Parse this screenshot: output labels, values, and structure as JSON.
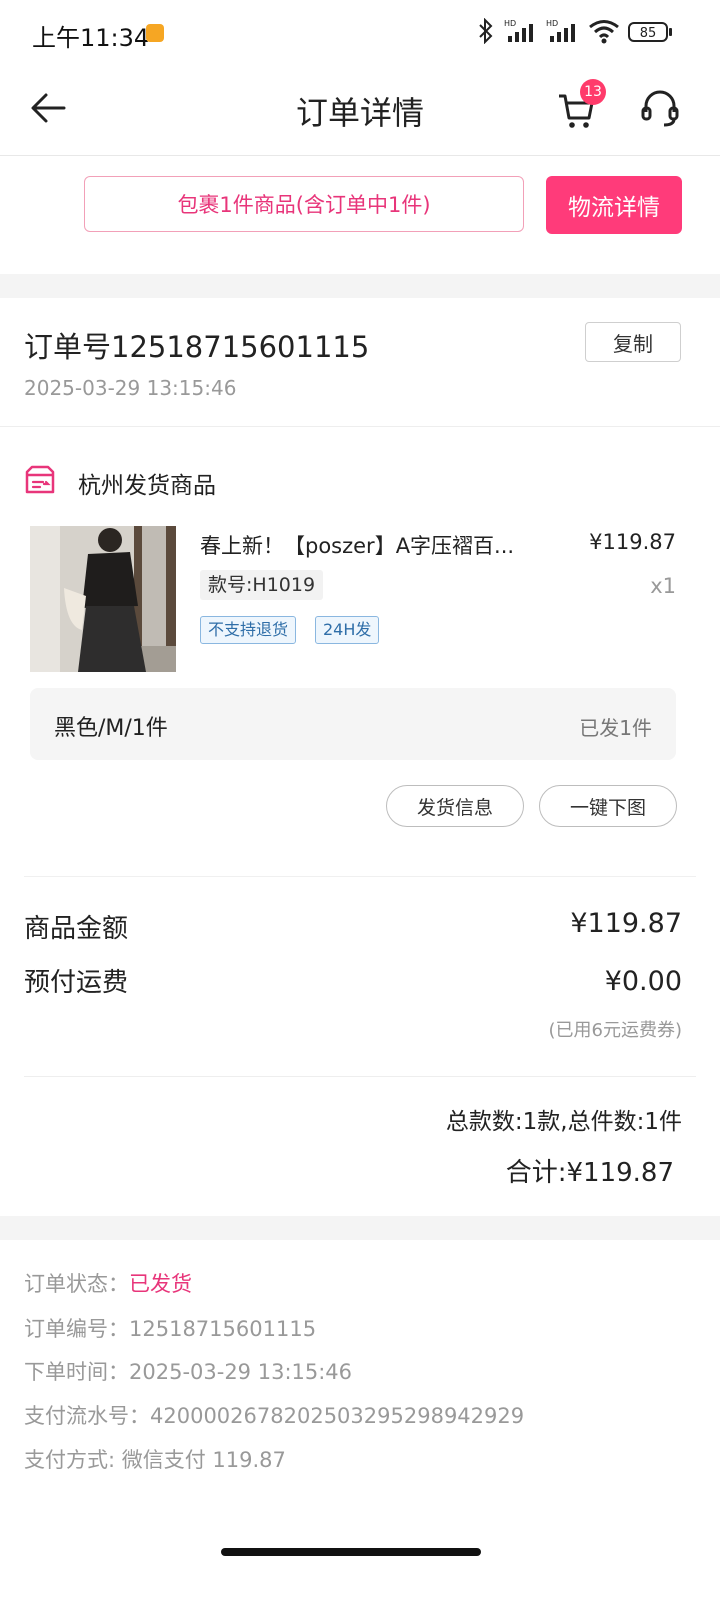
{
  "status_bar": {
    "time": "上午11:34",
    "battery": "85",
    "icons": [
      "bluetooth-icon",
      "signal-hd-icon",
      "signal-hd-icon",
      "wifi-icon",
      "battery-icon"
    ]
  },
  "header": {
    "title": "订单详情",
    "cart_badge": "13"
  },
  "package": {
    "summary": "包裹1件商品(含订单中1件)",
    "logistics_button": "物流详情"
  },
  "order": {
    "number_line": "订单号12518715601115",
    "time": "2025-03-29 13:15:46",
    "copy_button": "复制"
  },
  "shop": {
    "name": "杭州发货商品"
  },
  "product": {
    "name": "春上新！【poszer】A字压褶百...",
    "price": "¥119.87",
    "style_no": "款号:H1019",
    "quantity": "x1",
    "tags": [
      "不支持退货",
      "24H发"
    ],
    "sku": "黑色/M/1件",
    "sku_status": "已发1件"
  },
  "actions": {
    "shipping_info": "发货信息",
    "download_images": "一键下图"
  },
  "amounts": {
    "goods_label": "商品金额",
    "goods_value": "¥119.87",
    "shipping_label": "预付运费",
    "shipping_value": "¥0.00",
    "coupon_note": "(已用6元运费券)",
    "summary": "总款数:1款,总件数:1件",
    "total": "合计:¥119.87"
  },
  "info": {
    "status_label": "订单状态：",
    "status_value": "已发货",
    "order_no": "订单编号：12518715601115",
    "order_time": "下单时间：2025-03-29 13:15:46",
    "pay_serial": "支付流水号：4200002678202503295298942929",
    "pay_method": "支付方式: 微信支付 119.87"
  },
  "colors": {
    "accent": "#ff3b7a",
    "accent_text": "#e8357a",
    "badge": "#ff3b6b",
    "tag_blue": "#2f6ea8"
  }
}
